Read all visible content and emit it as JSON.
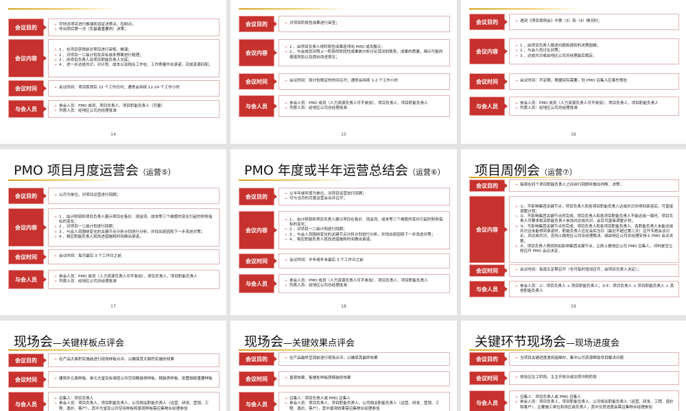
{
  "labels": {
    "purpose": "会议目的",
    "content": "会议内容",
    "time": "会议时间",
    "attendees": "与会人员"
  },
  "slides": [
    {
      "title": "",
      "purpose": [
        "尽快对项目进行推演和设定决策点、控制点；",
        "作出项目第一次（负最着重要的）决策；"
      ],
      "content": [
        "1 、在项目获得前对项目进行审视、推演；",
        "2 、对项目一二级计划及目标成本预案进行梳理；",
        "3 、向项目负责人及项目职能负责人交底；",
        "4 、进一步达成共识，对计划、成本以及相关工作包、工作质量作出承诺，完成资源匹配。"
      ],
      "time": [
        "会议时间：项目取得后 15 个工作日内；通常会持续 12-24 个工作小时"
      ],
      "attendees": [
        "参会人员：PMO 成员、项目负责人、项目职能负责人（尽量）",
        "列席人员：经地区公司总经理批准"
      ],
      "page": "14"
    },
    {
      "title": "",
      "purpose": [
        "对项目阶段性成果进行审查；"
      ],
      "content": [
        "1 、由项目负责人将阶段性成果逐项向 PMO 成员展示；",
        "2 、与会成员对照上一阶段的阶段性成果统分析讨论其间的联系，成果的质量，揭示可能的缩退风险以及提出改进意见；"
      ],
      "time": [
        "会议时间：按计划规定的时间召开；通常会持续 1-2 个工作小时"
      ],
      "attendees": [
        "参会人员：PMO 成员（人力资源负责人可不参加）、项目负责人、项目职能负责人",
        "列席人员：经地区公司总经理批准"
      ],
      "page": "15"
    },
    {
      "title": "",
      "purpose": [
        "遇到《项目周例会》中第（3）和（4）情况时；"
      ],
      "content": [
        "1 、由项目负责人报述问题和遇到的决策困难；",
        "2 、与会人员讨论对策；",
        "3 、达成共识或由地区公司总经理最后裁定。"
      ],
      "time": [
        "会议时间：不定期，根据实际需要，但 PMO 召集人应事先预告"
      ],
      "attendees": [
        "参会人员：PMO 成员（人力资源负责人可不参加）、项目负责人、项目职能负责人",
        "列席人员：经地区公司总经理批准"
      ],
      "page": "16"
    },
    {
      "title": "PMO 项目月度运营会",
      "subtitle": "（运营⑤）",
      "purpose": [
        "以月为单位，对项目运营进行回顾；"
      ],
      "content": [
        "1 、由计财部和项目负责人展示项目在售价、现金流、成本等三个维度的变化引起的财务指标的变化；",
        "2 、对项目一二级计划进行回顾；",
        "3 、与会人员围绕变化的关键节点分析计划进行分析，并找出原因和下一步改进对策；",
        "4 、相应职能负责人就改进措施和时间做出承诺。"
      ],
      "time": [
        "会议时间：每月最后 3 个工作日之前"
      ],
      "attendees": [
        "参会人员：PMO 成员（人力资源负责人可不参加）、项目负责人、项目职能负责人",
        "列席人员：经地区公司总经理批准"
      ],
      "page": "17"
    },
    {
      "title": "PMO 年度或半年运营总结会",
      "subtitle": "（运营⑥）",
      "purpose": [
        "以半年或年度为单位，对项目运营进行回顾；",
        "可与当月的月度运营会合并召开；"
      ],
      "content": [
        "1 、由计财部和项目负责人展示项目在售价、现金流、成本等三个维度的变化引起的财务指标的变化；",
        "2 、对项目一二级计划进行回顾；",
        "3 、与会人员围绕变化的关键节点分析计划进行分析，并找出原因和下一步改进对策；",
        "4 、相应职能负责人就改进措施和时间做出承诺。"
      ],
      "time": [
        "会议时间：半年或年末最后 3 个工作日之前"
      ],
      "attendees": [
        "参会人员：PMO 成员（人力资源负责人可不参加）、项目负责人、项目职能负责人",
        "列席人员：经地区公司总经理批准"
      ],
      "page": "18"
    },
    {
      "title": "项目周例会",
      "subtitle": "（运营⑦）",
      "purpose": [
        "每周在四个项目职能负责人之间自行回顾并做出判断、决策；"
      ],
      "content": [
        "①、不影响集团关键节点，项目负责人和各项目职能负责人达成共识并得到承诺后，可直接调整计划；",
        "②、不影响集团关键节点的完成，项目负责人和各项目职能负责人不能达成一致时，项目负责人可要求相关职能负责人参加并达成共识，会后可直接调整计划；",
        "③、不影响集团关键节点的完成，项目负责人和各项目职能负责人、各职能负责人未能达成共识且未能得到承诺时，职能负责人应在会后当日（最迟不超过第二天）召开专题会议讨论，并达成共识，否则上报地区公司总经理裁决，或由地区公司总经理安排上 PMO 会议决策。",
        "④、项目负责人预测到如影响集团关键节点，立即上报地区公司 PMO 召集人，评判是否立即召开 PMO 会议决定。"
      ],
      "time": [
        "会议时间：每周五定期召开（也可临时增加召开，由项目负责人决定）；"
      ],
      "attendees": [
        "参会人员：①：项目负责人 + 项目职能负责人；②③：项目负责人 + 项目职能负责人 + 其他职能负责人"
      ],
      "page": "19"
    },
    {
      "title": "现场会",
      "subtitle": "—关键样板点评会",
      "purpose": [
        "在产品大面积实施前进行现场样板点评，以确保其大面积实施的效果"
      ],
      "time": [
        "建筑外立面样板、单元大堂及标准层公共空间精装修样板、精装房样板、别墅细部重要样板"
      ],
      "attendees": [
        "召集人：项目负责人",
        "参会人员：项目负责人、项目职能负责人、公司相关职能负责人（运营、研发、营销、工程、造价、客户），其中大堂及公共空间样板和景观样板需召集物业经理参加"
      ]
    },
    {
      "title": "现场会",
      "subtitle": "—关键效果点评会",
      "purpose": [
        "在产品最终呈现前进行现场点评，以确保其最终效果"
      ],
      "time": [
        "景观效果、售楼处样板房精装修效果"
      ],
      "attendees": [
        "召集人：项目负责人或 PMO 召集人",
        "参会人员：项目负责人、项目职能负责人、公司相关职能负责人（运营、研发、营销、工程、造价、客户），其中景观效果需召集物业经理参加"
      ]
    },
    {
      "title": "关键环节现场会",
      "subtitle": "—现场进度会",
      "purpose": [
        "当项目关键进度遇到困难时，集中公司资源帮助项目解决问题"
      ],
      "time": [
        "体验区在工阶段，主主开放日或交房冲刺阶段"
      ],
      "attendees": [
        "召集人：项目负责人或 PMO 召集人",
        "参会人员：项目负责人、项目职能负责人、公司相关职能负责人（运营、研发、工程、造价和客户），主要施工单位和供应商负责人，其中交房进度会需召集物业经理参加"
      ]
    }
  ]
}
